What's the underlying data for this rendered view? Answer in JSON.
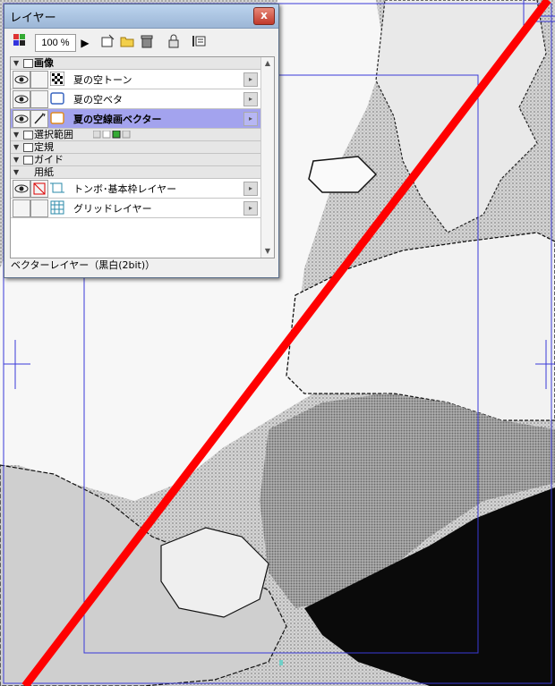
{
  "palette": {
    "title": "レイヤー",
    "close_glyph": "x",
    "toolbar": {
      "zoom": "100 %",
      "icons": [
        "color-palette-icon",
        "play-icon",
        "new-layer-icon",
        "new-folder-icon",
        "trash-icon",
        "lock-icon",
        "panel-menu-icon"
      ]
    },
    "groups": {
      "image": {
        "label": "画像"
      },
      "selection": {
        "label": "選択範囲"
      },
      "ruler": {
        "label": "定規"
      },
      "guide": {
        "label": "ガイド"
      },
      "paper": {
        "label": "用紙"
      }
    },
    "layers": [
      {
        "name": "夏の空トーン",
        "visible": true,
        "selected": false
      },
      {
        "name": "夏の空ベタ",
        "visible": true,
        "selected": false
      },
      {
        "name": "夏の空線画ベクター",
        "visible": true,
        "selected": true
      },
      {
        "name": "トンボ･基本枠レイヤー",
        "visible": true,
        "selected": false
      },
      {
        "name": "グリッドレイヤー",
        "visible": false,
        "selected": false
      }
    ],
    "status": "ベクターレイヤー（黒白(2bit)）"
  },
  "colors": {
    "guide_line": "#3a3ad8",
    "red_line": "#ff0000",
    "selected_row": "#a3a3ee",
    "title_bar": "#a9c2e0"
  }
}
